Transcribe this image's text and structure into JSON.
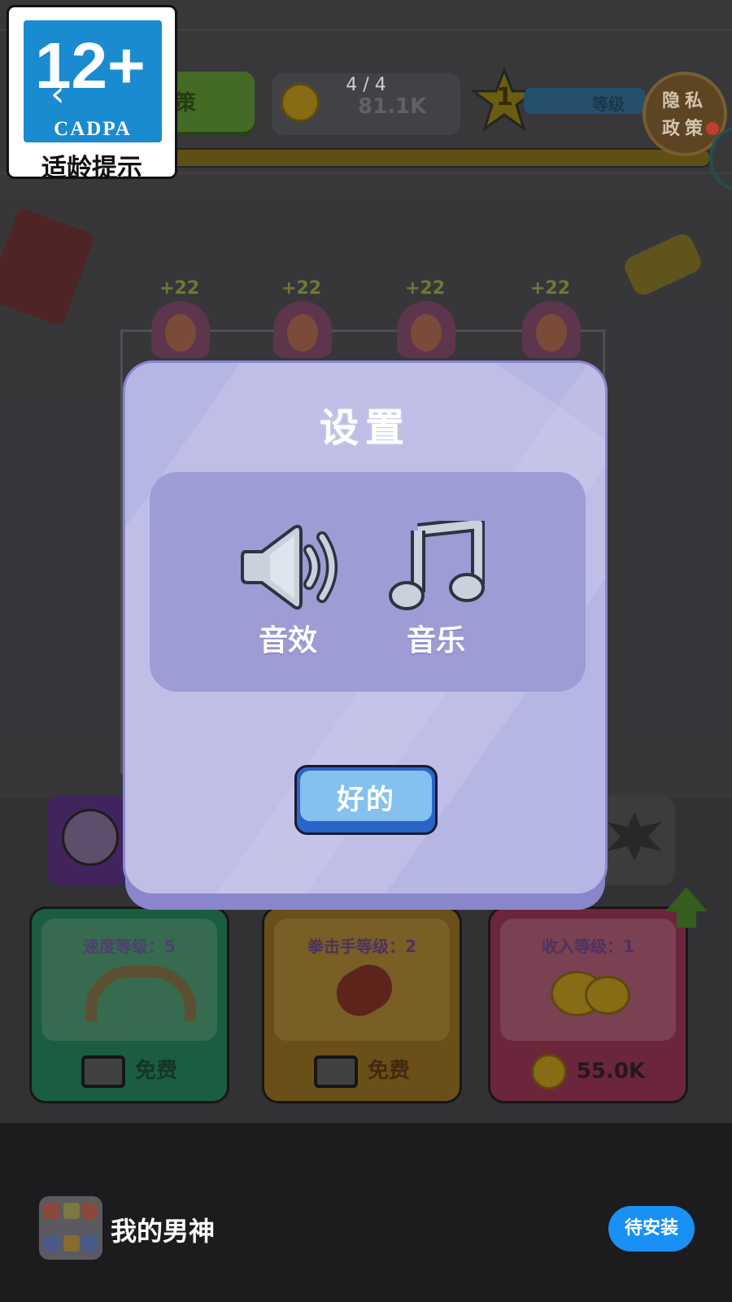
{
  "top_bar": {
    "green_button_label": "策",
    "page_indicator": "4 / 4",
    "coins": "81.1K",
    "star_level": "1",
    "level_bar_label": "等级",
    "privacy_line1": "隐私",
    "privacy_line2": "政策"
  },
  "age_rating": {
    "number": "12+",
    "org": "CADPA",
    "caption": "适龄提示"
  },
  "crowd": {
    "bonus_labels": [
      "+22",
      "+22",
      "+22",
      "+22"
    ]
  },
  "upgrade_cards": [
    {
      "title": "速度等级：5",
      "bottom": "免费",
      "color": "#1f6a4a"
    },
    {
      "title": "拳击手等级：2",
      "bottom": "免费",
      "color": "#7a5a1c"
    },
    {
      "title": "收入等级：1",
      "bottom": "55.0K",
      "color": "#7a2c44"
    }
  ],
  "settings_dialog": {
    "title": "设置",
    "sound_label": "音效",
    "music_label": "音乐",
    "ok_label": "好的",
    "colors": {
      "dialog": "#b6b6e4",
      "panel": "#9e9cd4",
      "ok_button": "#84c1ee"
    }
  },
  "install_bar": {
    "app_name": "我的男神",
    "install_label": "待安装",
    "accent": "#1a8ff5"
  }
}
